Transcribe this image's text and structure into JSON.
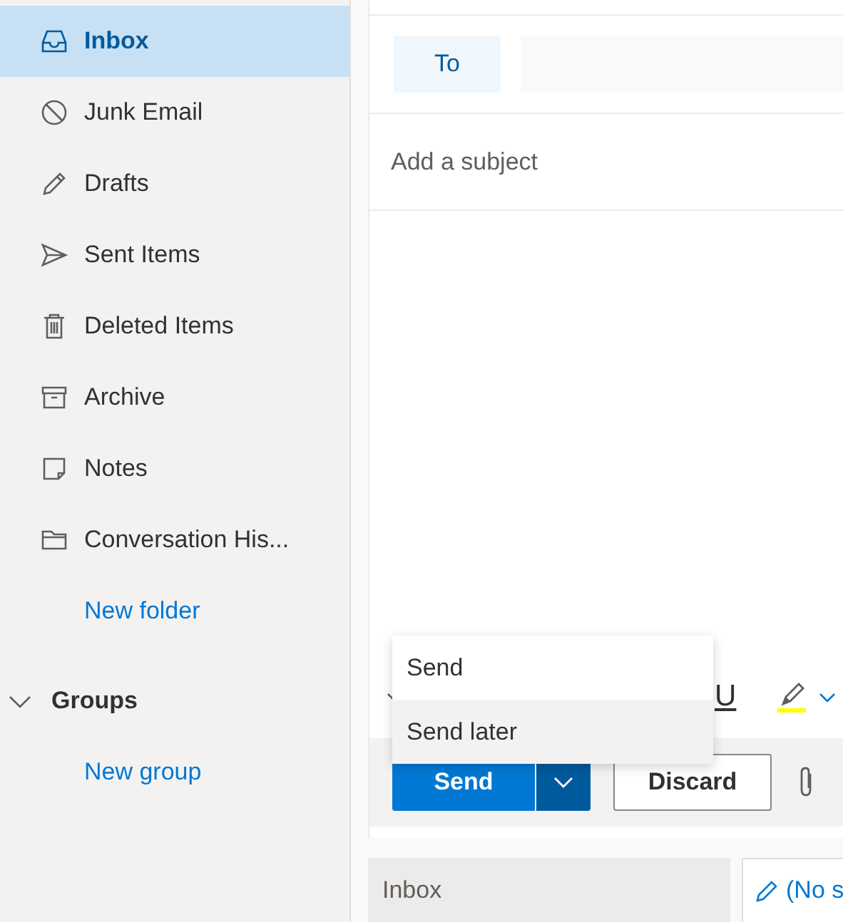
{
  "sidebar": {
    "folders": [
      {
        "label": "Inbox",
        "kind": "inbox",
        "selected": true
      },
      {
        "label": "Junk Email",
        "kind": "junk",
        "selected": false
      },
      {
        "label": "Drafts",
        "kind": "drafts",
        "selected": false
      },
      {
        "label": "Sent Items",
        "kind": "sent",
        "selected": false
      },
      {
        "label": "Deleted Items",
        "kind": "deleted",
        "selected": false
      },
      {
        "label": "Archive",
        "kind": "archive",
        "selected": false
      },
      {
        "label": "Notes",
        "kind": "notes",
        "selected": false
      },
      {
        "label": "Conversation His...",
        "kind": "folder",
        "selected": false
      }
    ],
    "new_folder": "New folder",
    "groups": {
      "label": "Groups",
      "expanded": true,
      "new_group": "New group"
    }
  },
  "compose": {
    "to_button": "To",
    "subject_placeholder": "Add a subject",
    "toolbar": {
      "underline": "U"
    },
    "send_button": "Send",
    "discard_button": "Discard",
    "send_menu": [
      {
        "label": "Send",
        "selected": false
      },
      {
        "label": "Send later",
        "selected": true
      }
    ]
  },
  "bottom_tabs": [
    {
      "label": "Inbox",
      "kind": "folder",
      "selected": false
    },
    {
      "label": "(No s",
      "kind": "draft",
      "selected": true
    }
  ]
}
